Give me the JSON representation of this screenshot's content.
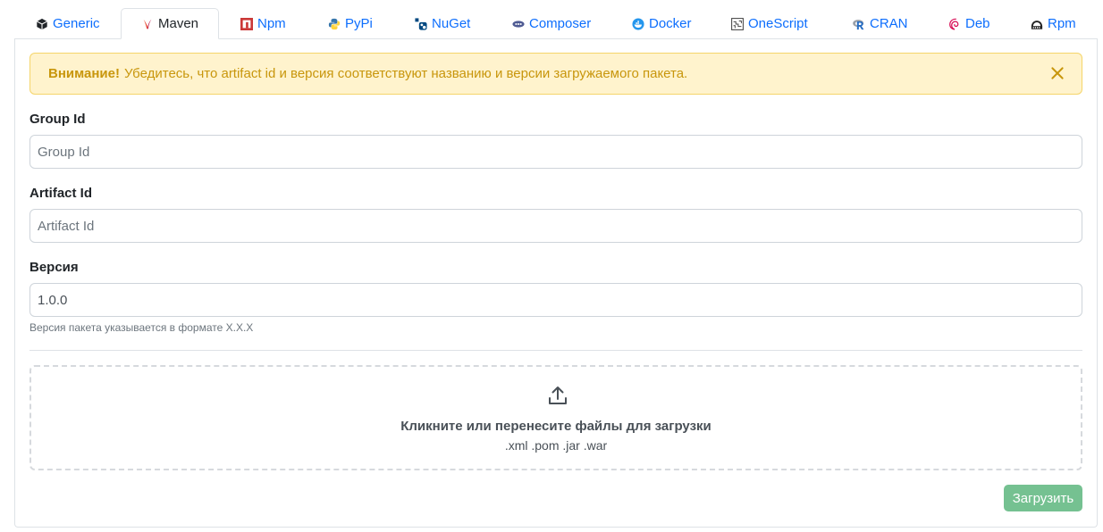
{
  "tabs": [
    {
      "label": "Generic",
      "icon": "box-icon"
    },
    {
      "label": "Maven",
      "icon": "maven-feather-icon"
    },
    {
      "label": "Npm",
      "icon": "npm-icon"
    },
    {
      "label": "PyPi",
      "icon": "python-icon"
    },
    {
      "label": "NuGet",
      "icon": "nuget-icon"
    },
    {
      "label": "Composer",
      "icon": "composer-icon"
    },
    {
      "label": "Docker",
      "icon": "docker-icon"
    },
    {
      "label": "OneScript",
      "icon": "onescript-icon"
    },
    {
      "label": "CRAN",
      "icon": "r-icon"
    },
    {
      "label": "Deb",
      "icon": "debian-icon"
    },
    {
      "label": "Rpm",
      "icon": "rpm-icon"
    }
  ],
  "active_tab": "Maven",
  "alert": {
    "strong": "Внимание!",
    "text": "Убедитесь, что artifact id и версия соответствуют названию и версии загружаемого пакета."
  },
  "form": {
    "group_id": {
      "label": "Group Id",
      "placeholder": "Group Id",
      "value": ""
    },
    "artifact_id": {
      "label": "Artifact Id",
      "placeholder": "Artifact Id",
      "value": ""
    },
    "version": {
      "label": "Версия",
      "value": "1.0.0",
      "help": "Версия пакета указывается в формате X.X.X"
    }
  },
  "dropzone": {
    "title": "Кликните или перенесите файлы для загрузки",
    "extensions": ".xml .pom .jar .war"
  },
  "submit_label": "Загрузить",
  "colors": {
    "link": "#0d6efd",
    "alert_bg": "#fff3cd",
    "alert_text": "#c8960c",
    "submit_bg": "#75c191"
  }
}
